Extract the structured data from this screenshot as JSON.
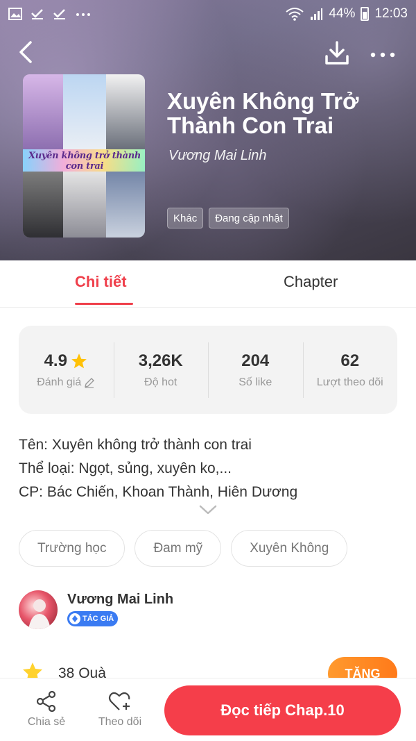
{
  "status_bar": {
    "battery": "44%",
    "time": "12:03",
    "left_icons": [
      "image-icon",
      "check-icon",
      "check-icon",
      "more-dots-icon"
    ]
  },
  "header": {
    "title": "Xuyên Không Trở Thành Con Trai",
    "author": "Vương Mai Linh",
    "tags": [
      "Khác",
      "Đang cập nhật"
    ],
    "cover_text": "Xuyên không trở thành con trai"
  },
  "tabs": [
    {
      "label": "Chi tiết",
      "active": true
    },
    {
      "label": "Chapter",
      "active": false
    }
  ],
  "stats": [
    {
      "value": "4.9",
      "label": "Đánh giá"
    },
    {
      "value": "3,26K",
      "label": "Độ hot"
    },
    {
      "value": "204",
      "label": "Số like"
    },
    {
      "value": "62",
      "label": "Lượt theo dõi"
    }
  ],
  "description": [
    "Tên: Xuyên không trở thành con trai",
    "Thể loại: Ngọt, sủng, xuyên ko,...",
    "CP: Bác Chiến, Khoan Thành, Hiên Dương"
  ],
  "genres": [
    "Trường học",
    "Đam mỹ",
    "Xuyên Không"
  ],
  "author_section": {
    "name": "Vương Mai Linh",
    "badge": "TÁC GIẢ"
  },
  "gifts": {
    "count_text": "38 Quà",
    "button_label": "TẶNG"
  },
  "bottom_bar": {
    "share_label": "Chia sẻ",
    "follow_label": "Theo dõi",
    "read_label": "Đọc tiếp Chap.10"
  },
  "colors": {
    "accent": "#f53e4a",
    "tab_active": "#ef3f4b",
    "gift_button": "#ff8a24",
    "badge": "#3a7bf2"
  }
}
